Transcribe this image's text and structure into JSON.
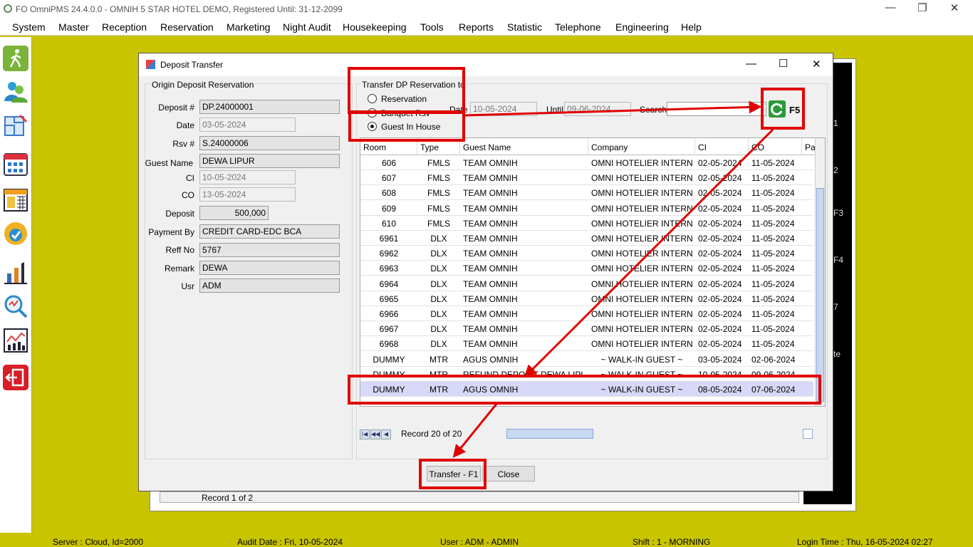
{
  "window": {
    "title": "FO OmniPMS 24.4.0.0 - OMNIH 5 STAR HOTEL DEMO, Registered Until: 31-12-2099",
    "min": "—",
    "restore": "❐",
    "close": "✕"
  },
  "menu": [
    "System",
    "Master",
    "Reception",
    "Reservation",
    "Marketing",
    "Night Audit",
    "Housekeeping",
    "Tools",
    "Reports",
    "Statistic",
    "Telephone",
    "Engineering",
    "Help"
  ],
  "sidebar_icons": [
    "walk-in-icon",
    "guests-icon",
    "floor-plan-icon",
    "calendar-grid-icon",
    "calendar-2023-icon",
    "available-badge-icon",
    "housekeeping-icon",
    "search-analytics-icon",
    "chart-icon",
    "exit-icon"
  ],
  "status": {
    "server": "Server : Cloud, Id=2000",
    "audit": "Audit Date : Fri, 10-05-2024",
    "user": "User : ADM - ADMIN",
    "shift": "Shift : 1 - MORNING",
    "login": "Login Time : Thu, 16-05-2024 02:27"
  },
  "background": {
    "record": "Record 1 of 2",
    "side_labels": [
      "1",
      "2",
      "F3",
      "F4",
      "7",
      "te"
    ]
  },
  "dialog": {
    "title": "Deposit Transfer",
    "min": "—",
    "max": "☐",
    "close": "✕",
    "origin": {
      "group": "Origin Deposit Reservation",
      "deposit_no_label": "Deposit #",
      "deposit_no": "DP.24000001",
      "date_label": "Date",
      "date": "03-05-2024",
      "rsv_label": "Rsv #",
      "rsv": "S.24000006",
      "guest_label": "Guest Name",
      "guest": "DEWA LIPUR",
      "ci_label": "CI",
      "ci": "10-05-2024",
      "co_label": "CO",
      "co": "13-05-2024",
      "deposit_label": "Deposit",
      "deposit": "500,000",
      "payment_label": "Payment By",
      "payment": "CREDIT CARD-EDC BCA",
      "reff_label": "Reff No",
      "reff": "5767",
      "remark_label": "Remark",
      "remark": "DEWA",
      "usr_label": "Usr",
      "usr": "ADM"
    },
    "transfer": {
      "group": "Transfer DP Reservation to",
      "opt1": "Reservation",
      "opt2": "Banquet Rsv",
      "opt3": "Guest In House",
      "date_label": "Date",
      "date": "10-05-2024",
      "until_label": "Until",
      "until": "09-06-2024",
      "search_label": "Search",
      "search_value": "",
      "refresh_key": "F5"
    },
    "grid": {
      "columns": [
        "Room",
        "Type",
        "Guest Name",
        "Company",
        "CI",
        "CO",
        "Pa"
      ],
      "rows": [
        [
          "606",
          "FMLS",
          "TEAM OMNIH",
          "OMNI HOTELIER INTERNAS...",
          "02-05-2024",
          "11-05-2024"
        ],
        [
          "607",
          "FMLS",
          "TEAM OMNIH",
          "OMNI HOTELIER INTERNAS...",
          "02-05-2024",
          "11-05-2024"
        ],
        [
          "608",
          "FMLS",
          "TEAM OMNIH",
          "OMNI HOTELIER INTERNAS...",
          "02-05-2024",
          "11-05-2024"
        ],
        [
          "609",
          "FMLS",
          "TEAM OMNIH",
          "OMNI HOTELIER INTERNAS...",
          "02-05-2024",
          "11-05-2024"
        ],
        [
          "610",
          "FMLS",
          "TEAM OMNIH",
          "OMNI HOTELIER INTERNAS...",
          "02-05-2024",
          "11-05-2024"
        ],
        [
          "6961",
          "DLX",
          "TEAM OMNIH",
          "OMNI HOTELIER INTERNAS...",
          "02-05-2024",
          "11-05-2024"
        ],
        [
          "6962",
          "DLX",
          "TEAM OMNIH",
          "OMNI HOTELIER INTERNAS...",
          "02-05-2024",
          "11-05-2024"
        ],
        [
          "6963",
          "DLX",
          "TEAM OMNIH",
          "OMNI HOTELIER INTERNAS...",
          "02-05-2024",
          "11-05-2024"
        ],
        [
          "6964",
          "DLX",
          "TEAM OMNIH",
          "OMNI HOTELIER INTERNAS...",
          "02-05-2024",
          "11-05-2024"
        ],
        [
          "6965",
          "DLX",
          "TEAM OMNIH",
          "OMNI HOTELIER INTERNAS...",
          "02-05-2024",
          "11-05-2024"
        ],
        [
          "6966",
          "DLX",
          "TEAM OMNIH",
          "OMNI HOTELIER INTERNAS...",
          "02-05-2024",
          "11-05-2024"
        ],
        [
          "6967",
          "DLX",
          "TEAM OMNIH",
          "OMNI HOTELIER INTERNAS...",
          "02-05-2024",
          "11-05-2024"
        ],
        [
          "6968",
          "DLX",
          "TEAM OMNIH",
          "OMNI HOTELIER INTERNAS...",
          "02-05-2024",
          "11-05-2024"
        ],
        [
          "DUMMY",
          "MTR",
          "AGUS OMNIH",
          "~ WALK-IN GUEST ~",
          "03-05-2024",
          "02-06-2024"
        ],
        [
          "DUMMY",
          "MTR",
          "REFUND DEPOSIT DEWA LIPUR",
          "~ WALK-IN GUEST ~",
          "10-05-2024",
          "09-06-2024"
        ],
        [
          "DUMMY",
          "MTR",
          "AGUS OMNIH",
          "~ WALK-IN GUEST ~",
          "08-05-2024",
          "07-06-2024"
        ]
      ],
      "selected_index": 15,
      "record": "Record 20 of 20"
    },
    "buttons": {
      "transfer": "Transfer - F1",
      "close": "Close"
    }
  },
  "colors": {
    "accent_red": "#e00000",
    "olive_bg": "#c8c400",
    "selected_row": "#d8d8f8"
  }
}
